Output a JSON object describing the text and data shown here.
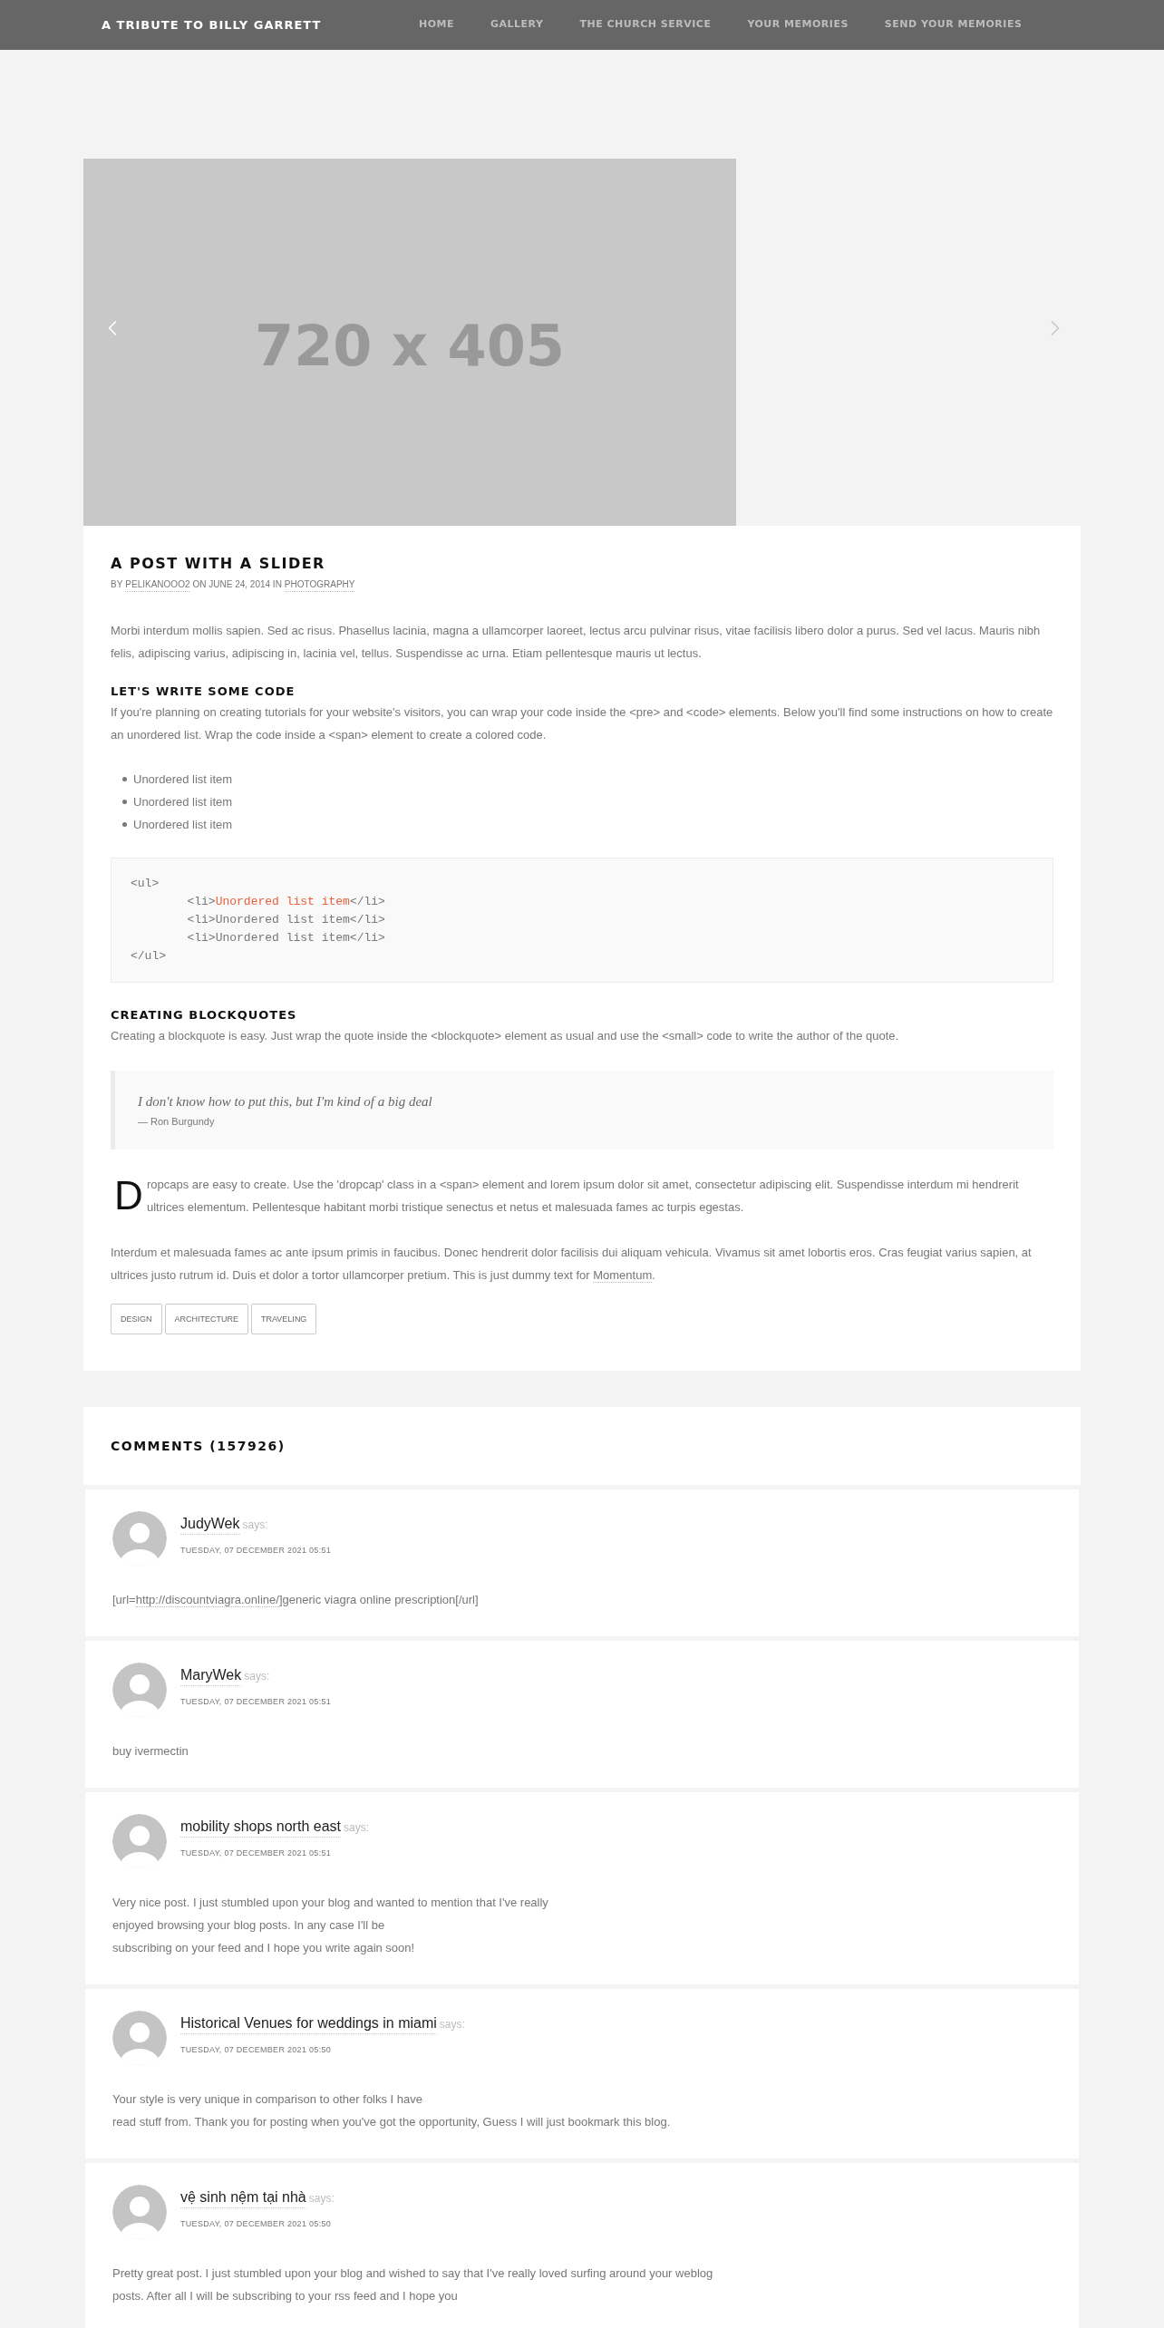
{
  "nav": {
    "brand": "A TRIBUTE TO BILLY GARRETT",
    "links": [
      {
        "label": "HOME"
      },
      {
        "label": "GALLERY"
      },
      {
        "label": "THE CHURCH SERVICE"
      },
      {
        "label": "YOUR MEMORIES"
      },
      {
        "label": "SEND YOUR MEMORIES"
      }
    ]
  },
  "slider": {
    "placeholder_text": "720 x 405"
  },
  "post": {
    "title": "A POST WITH A SLIDER",
    "meta": {
      "by": "BY",
      "author": "PELIKANOOO2",
      "on": "ON JUNE 24, 2014 IN",
      "category": "PHOTOGRAPHY"
    },
    "intro": "Morbi interdum mollis sapien. Sed ac risus. Phasellus lacinia, magna a ullamcorper laoreet, lectus arcu pulvinar risus, vitae facilisis libero dolor a purus. Sed vel lacus. Mauris nibh felis, adipiscing varius, adipiscing in, lacinia vel, tellus. Suspendisse ac urna. Etiam pellentesque mauris ut lectus.",
    "code_heading": "LET'S WRITE SOME CODE",
    "code_text": "If you're planning on creating tutorials for your website's visitors, you can wrap your code inside the <pre> and <code> elements. Below you'll find some instructions on how to create an unordered list. Wrap the code inside a <span> element to create a colored code.",
    "list": [
      "Unordered list item",
      "Unordered list item",
      "Unordered list item"
    ],
    "code_lines": [
      {
        "text": "<ul>"
      },
      {
        "text": "\t<li>",
        "highlighted": "Unordered list item",
        "after": "</li>"
      },
      {
        "text": "\t<li>Unordered list item</li>"
      },
      {
        "text": "\t<li>Unordered list item</li>"
      },
      {
        "text": "</ul>"
      }
    ],
    "quote_heading": "CREATING BLOCKQUOTES",
    "quote_text": "Creating a blockquote is easy. Just wrap the quote inside the <blockquote> element as usual and use the <small> code to write the author of the quote.",
    "quote": "I don't know how to put this, but I'm kind of a big deal",
    "quote_author": "— Ron Burgundy",
    "dropcap": "D",
    "dropcap_text": "ropcaps are easy to create. Use the 'dropcap' class in a <span> element and lorem ipsum dolor sit amet, consectetur adipiscing elit. Suspendisse interdum mi hendrerit ultrices elementum. Pellentesque habitant morbi tristique senectus et netus et malesuada fames ac turpis egestas.",
    "outro": "Interdum et malesuada fames ac ante ipsum primis in faucibus. Donec hendrerit dolor facilisis dui aliquam vehicula. Vivamus sit amet lobortis eros. Cras feugiat varius sapien, at ultrices justo rutrum id. Duis et dolor a tortor ullamcorper pretium. This is just dummy text for",
    "outro_link": "Momentum",
    "outro_end": ".",
    "tags": [
      "DESIGN",
      "ARCHITECTURE",
      "TRAVELING"
    ]
  },
  "comments": {
    "heading": "COMMENTS (157926)",
    "items": [
      {
        "name": "JudyWek",
        "says": "says:",
        "date": "TUESDAY, 07 DECEMBER 2021 05:51",
        "lines": [
          {
            "before": "[url=",
            "link": "http://discountviagra.online/",
            "after": "]generic viagra online prescription[/url]"
          }
        ]
      },
      {
        "name": "MaryWek",
        "says": "says:",
        "date": "TUESDAY, 07 DECEMBER 2021 05:51",
        "lines": [
          {
            "before": "buy ivermectin"
          }
        ]
      },
      {
        "name": "mobility shops north east",
        "says": "says:",
        "date": "TUESDAY, 07 DECEMBER 2021 05:51",
        "lines": [
          {
            "before": "Very nice post. I just stumbled upon your blog and wanted to mention that I've really"
          },
          {
            "before": "enjoyed browsing your blog posts. In any case I'll be"
          },
          {
            "before": "subscribing on your feed and I hope you write again soon!"
          }
        ]
      },
      {
        "name": "Historical Venues for weddings in miami",
        "says": "says:",
        "date": "TUESDAY, 07 DECEMBER 2021 05:50",
        "lines": [
          {
            "before": "Your style is very unique in comparison to other folks I have"
          },
          {
            "before": "read stuff from. Thank you for posting when you've got the opportunity, Guess I will just bookmark this blog."
          }
        ]
      },
      {
        "name": "vệ sinh nệm tại nhà",
        "says": "says:",
        "date": "TUESDAY, 07 DECEMBER 2021 05:50",
        "lines": [
          {
            "before": "Pretty great post. I just stumbled upon your blog and wished to say that I've really loved surfing around your weblog"
          },
          {
            "before": "posts. After all I will be subscribing to your rss feed and I hope you"
          }
        ]
      }
    ]
  }
}
